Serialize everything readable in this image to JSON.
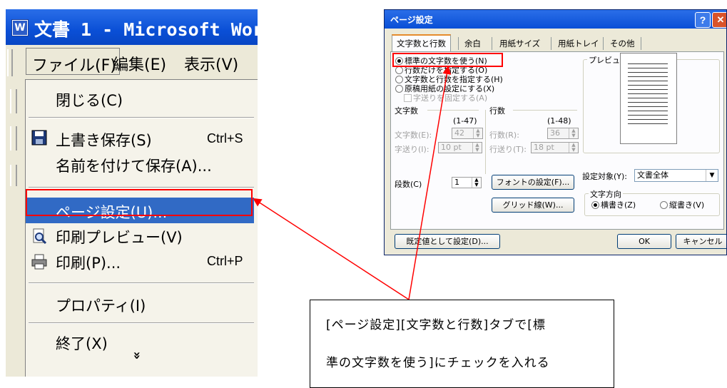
{
  "word": {
    "app_icon": "word-document-icon",
    "title": "文書 1 - Microsoft Wor",
    "menubar": [
      "ファイル(F)",
      "編集(E)",
      "表示(V)"
    ],
    "file_menu": {
      "close": "閉じる(C)",
      "save": "上書き保存(S)",
      "save_shortcut": "Ctrl+S",
      "save_as": "名前を付けて保存(A)...",
      "page_setup": "ページ設定(U)...",
      "print_preview": "印刷プレビュー(V)",
      "print": "印刷(P)...",
      "print_shortcut": "Ctrl+P",
      "properties": "プロパティ(I)",
      "exit": "終了(X)",
      "expand": "»"
    }
  },
  "dialog": {
    "title": "ページ設定",
    "help": "?",
    "close": "✕",
    "tabs": [
      "文字数と行数",
      "余白",
      "用紙サイズ",
      "用紙トレイ",
      "その他"
    ],
    "grid_options": [
      "標準の文字数を使う(N)",
      "行数だけを指定する(O)",
      "文字数と行数を指定する(H)",
      "原稿用紙の設定にする(X)"
    ],
    "fixed_pitch": "字送りを固定する(A)",
    "preview_label": "プレビュー",
    "chars_group": "文字数",
    "chars_range": "(1-47)",
    "chars_label": "文字数(E):",
    "chars_value": "42",
    "char_pitch_label": "字送り(I):",
    "char_pitch_value": "10 pt",
    "lines_group": "行数",
    "lines_range": "(1-48)",
    "lines_label": "行数(R):",
    "lines_value": "36",
    "line_pitch_label": "行送り(T):",
    "line_pitch_value": "18 pt",
    "columns_label": "段数(C)",
    "columns_value": "1",
    "font_button": "フォントの設定(F)...",
    "grid_button": "グリッド線(W)...",
    "apply_to_label": "設定対象(Y):",
    "apply_to_value": "文書全体",
    "direction_group": "文字方向",
    "dir_horizontal": "横書き(Z)",
    "dir_vertical": "縦書き(V)",
    "default_button": "既定値として設定(D)...",
    "ok_button": "OK",
    "cancel_button": "キャンセル"
  },
  "callout": {
    "line1": "[ページ設定][文字数と行数]タブで[標",
    "line2": "準の文字数を使う]にチェックを入れる"
  },
  "colors": {
    "highlight_border": "#ff0000",
    "menu_selection": "#316ac5",
    "xp_title_blue": "#0a4fd6"
  }
}
